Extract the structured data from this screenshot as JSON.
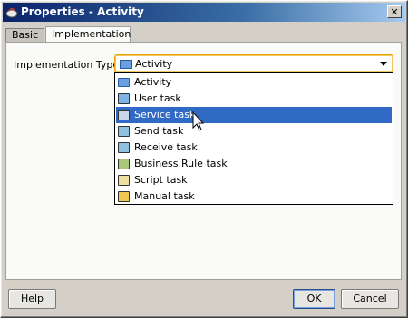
{
  "window": {
    "title": "Properties - Activity",
    "close_glyph": "✕"
  },
  "tabs": [
    {
      "label": "Basic"
    },
    {
      "label": "Implementation"
    }
  ],
  "form": {
    "implementation_label": "Implementation Type:",
    "implementation_value": "Activity"
  },
  "dropdown": {
    "items": [
      {
        "label": "Activity",
        "icon": "activity-icon",
        "selected": false
      },
      {
        "label": "User task",
        "icon": "user-task-icon",
        "selected": false
      },
      {
        "label": "Service task",
        "icon": "service-task-icon",
        "selected": true
      },
      {
        "label": "Send task",
        "icon": "send-task-icon",
        "selected": false
      },
      {
        "label": "Receive task",
        "icon": "receive-task-icon",
        "selected": false
      },
      {
        "label": "Business Rule task",
        "icon": "business-rule-task-icon",
        "selected": false
      },
      {
        "label": "Script task",
        "icon": "script-task-icon",
        "selected": false
      },
      {
        "label": "Manual task",
        "icon": "manual-task-icon",
        "selected": false
      }
    ]
  },
  "buttons": {
    "help": "Help",
    "ok": "OK",
    "cancel": "Cancel"
  },
  "colors": {
    "selection": "#316ac5",
    "focus_border": "#e6a200",
    "title_gradient_start": "#0a246a"
  }
}
